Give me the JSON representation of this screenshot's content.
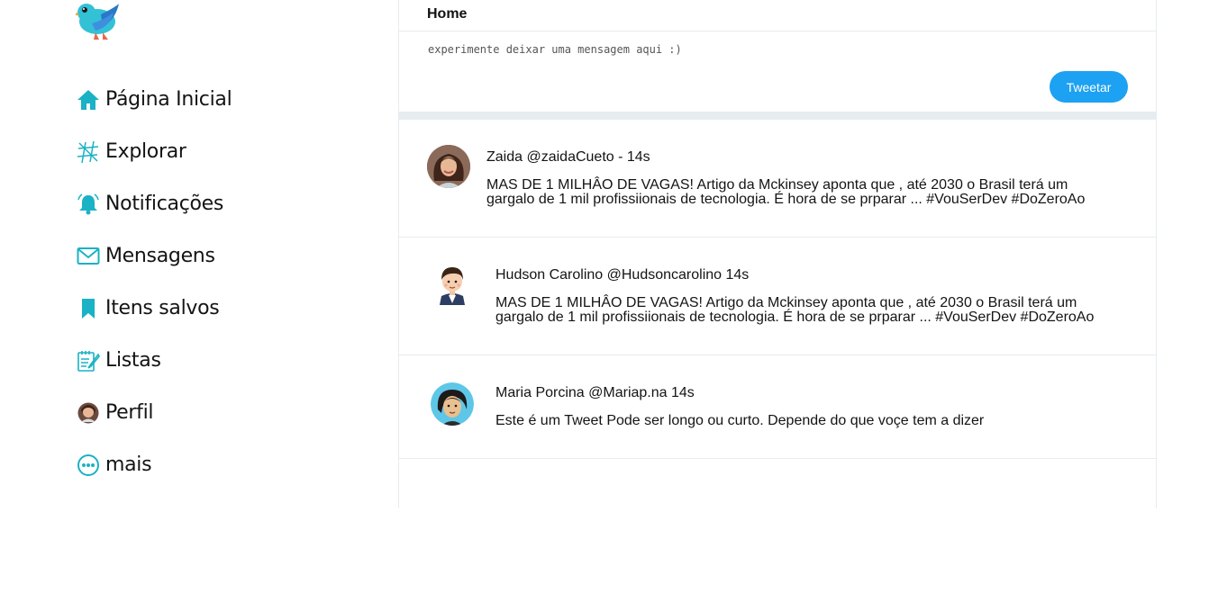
{
  "sidebar": {
    "logo_icon": "bird-logo",
    "items": [
      {
        "label": "Página Inicial",
        "icon": "home-icon"
      },
      {
        "label": "Explorar",
        "icon": "hashtag-icon"
      },
      {
        "label": "Notificações",
        "icon": "bell-icon"
      },
      {
        "label": "Mensagens",
        "icon": "envelope-icon"
      },
      {
        "label": "Itens salvos",
        "icon": "bookmark-icon"
      },
      {
        "label": "Listas",
        "icon": "list-icon"
      },
      {
        "label": "Perfil",
        "icon": "profile-avatar-icon"
      },
      {
        "label": "mais",
        "icon": "more-icon"
      }
    ]
  },
  "header": {
    "title": "Home"
  },
  "composer": {
    "placeholder": "experimente deixar uma mensagem aqui :)",
    "button_label": "Tweetar"
  },
  "tweets": [
    {
      "author": "Zaida @zaidaCueto - 14s",
      "text": "MAS DE 1 MILHÂO DE VAGAS! Artigo da Mckinsey aponta que , até 2030 o Brasil terá um gargalo de 1 mil profissiionais de tecnologia. É hora de se prparar ... #VouSerDev #DoZeroAo",
      "avatar": "photo-avatar"
    },
    {
      "author": "Hudson Carolino @Hudsoncarolino 14s",
      "text": "MAS DE 1 MILHÂO DE VAGAS! Artigo da Mckinsey aponta que , até 2030 o Brasil terá um gargalo de 1 mil profissiionais de tecnologia. É hora de se prparar ... #VouSerDev #DoZeroAo",
      "avatar": "cartoon-boy-avatar"
    },
    {
      "author": "Maria Porcina @Mariap.na 14s",
      "text": "Este é um Tweet Pode ser longo ou curto. Depende do que voçe tem a dizer",
      "avatar": "cartoon-woman-avatar"
    }
  ],
  "colors": {
    "accent": "#1da1f2",
    "icon_teal": "#1ab2c4",
    "divider": "#e6ecf0"
  }
}
